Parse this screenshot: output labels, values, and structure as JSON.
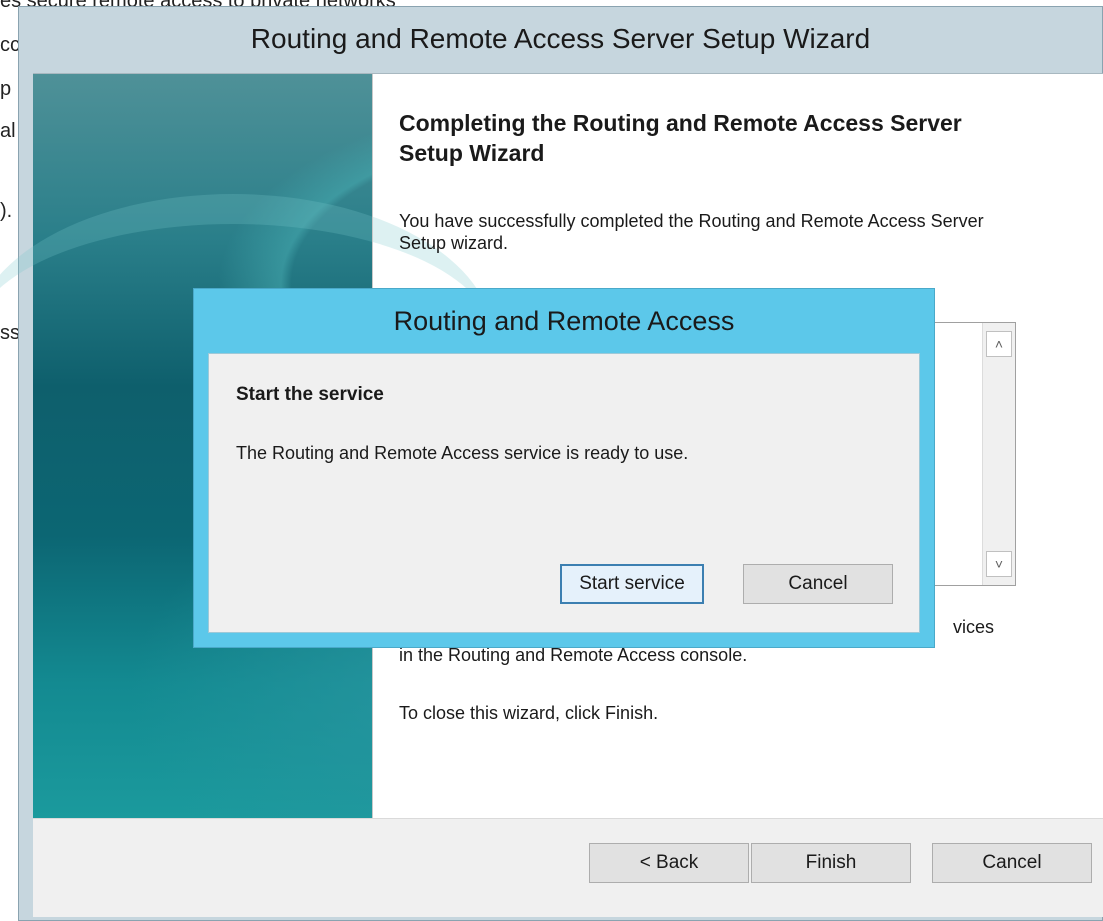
{
  "background_app": {
    "lines": [
      "es secure remote access to private networks",
      "cc",
      "p",
      "al",
      ").",
      "ss"
    ]
  },
  "wizard": {
    "title": "Routing and Remote Access Server Setup Wizard",
    "heading": "Completing the Routing and Remote Access Server Setup Wizard",
    "intro": "You have successfully completed the Routing and Remote Access Server Setup wizard.",
    "after_summary_partial": "vices",
    "console_line": "in the Routing and Remote Access console.",
    "close_text": "To close this wizard, click Finish.",
    "buttons": {
      "back": "< Back",
      "finish": "Finish",
      "cancel": "Cancel"
    }
  },
  "dialog": {
    "title": "Routing and Remote Access",
    "heading": "Start the service",
    "message": "The Routing and Remote Access service is ready to use.",
    "buttons": {
      "start": "Start service",
      "cancel": "Cancel"
    }
  },
  "scroll": {
    "up_glyph": "˄",
    "down_glyph": "˅"
  },
  "colors": {
    "dialog_titlebar": "#5cc8ea",
    "wizard_titlebar": "#c6d6de",
    "focus_border": "#3c7fb1"
  }
}
